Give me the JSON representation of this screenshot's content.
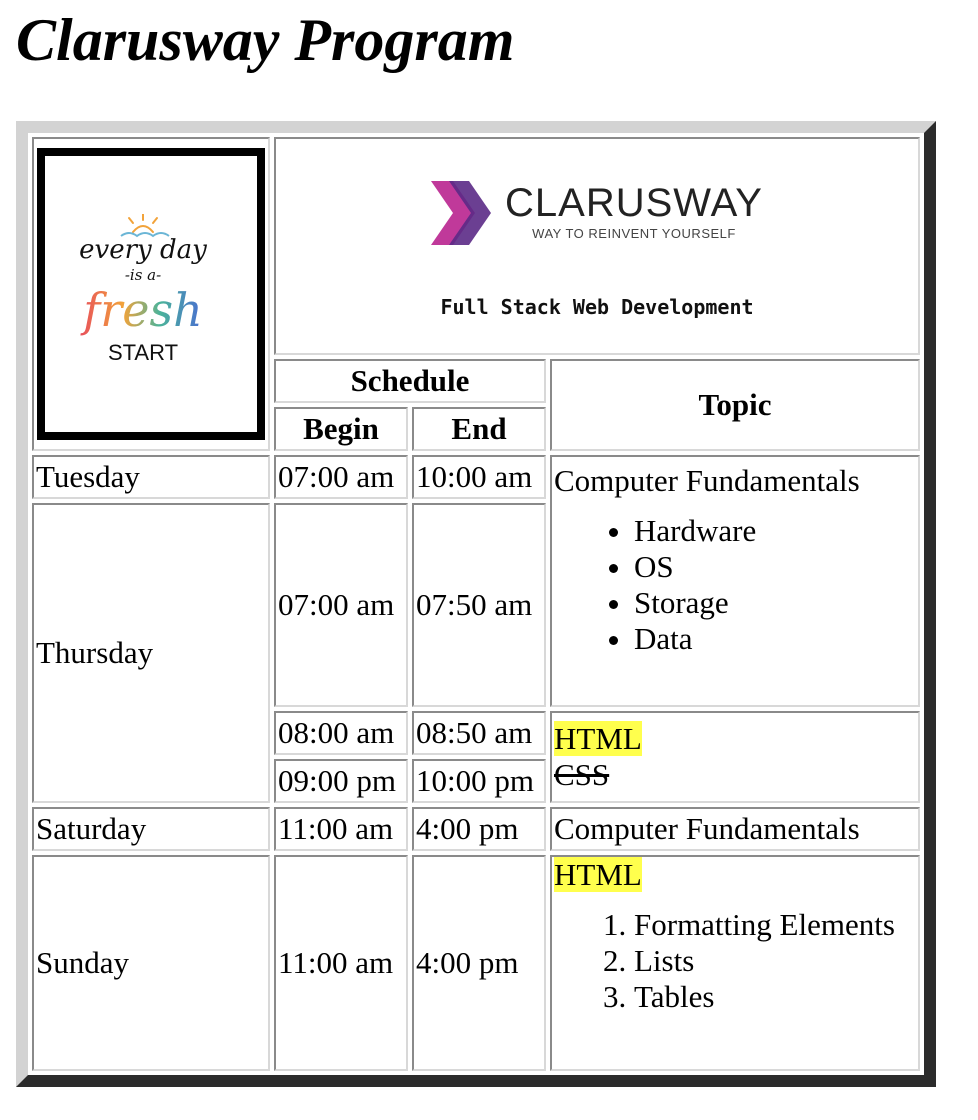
{
  "page_title": "Clarusway Program",
  "poster": {
    "line1": "every day",
    "line2": "-is a-",
    "line3": "fresh",
    "line4": "START"
  },
  "brand": {
    "name": "CLARUSWAY",
    "tagline": "WAY TO REINVENT YOURSELF",
    "program": "Full Stack Web Development"
  },
  "headers": {
    "schedule": "Schedule",
    "begin": "Begin",
    "end": "End",
    "topic": "Topic"
  },
  "rows": {
    "tuesday": {
      "day": "Tuesday",
      "begin": "07:00 am",
      "end": "10:00 am"
    },
    "thursday": {
      "day": "Thursday",
      "slot1": {
        "begin": "07:00 am",
        "end": "07:50 am"
      },
      "slot2": {
        "begin": "08:00 am",
        "end": "08:50 am"
      },
      "slot3": {
        "begin": "09:00 pm",
        "end": "10:00 pm"
      }
    },
    "saturday": {
      "day": "Saturday",
      "begin": "11:00 am",
      "end": "4:00 pm"
    },
    "sunday": {
      "day": "Sunday",
      "begin": "11:00 am",
      "end": "4:00 pm"
    }
  },
  "topics": {
    "computer_fundamentals": "Computer Fundamentals",
    "cf_items": [
      "Hardware",
      "OS",
      "Storage",
      "Data"
    ],
    "html": "HTML",
    "css": "CSS",
    "saturday_topic": "Computer Fundamentals",
    "sunday_html": "HTML",
    "sunday_items": [
      "Formatting Elements",
      "Lists",
      "Tables"
    ]
  },
  "colors": {
    "highlight": "#ffff4d",
    "brand_chevron_dark": "#5b2a86",
    "brand_chevron_light": "#c0399a"
  }
}
